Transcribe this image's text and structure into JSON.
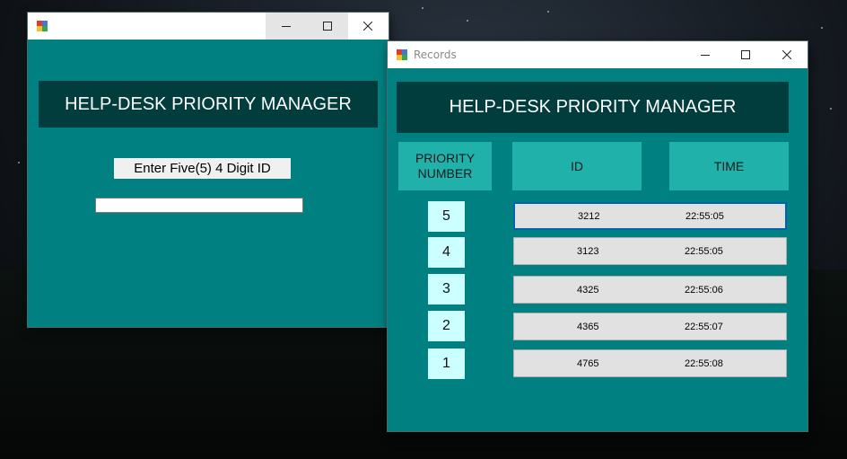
{
  "window_main": {
    "title": "",
    "banner": "HELP-DESK PRIORITY MANAGER",
    "prompt_label": "Enter Five(5) 4 Digit ID",
    "id_input_value": ""
  },
  "window_records": {
    "title": "Records",
    "banner": "HELP-DESK PRIORITY MANAGER",
    "headers": {
      "priority": "PRIORITY NUMBER",
      "id": "ID",
      "time": "TIME"
    },
    "rows": [
      {
        "priority": "5",
        "id": "3212",
        "time": "22:55:05"
      },
      {
        "priority": "4",
        "id": "3123",
        "time": "22:55:05"
      },
      {
        "priority": "3",
        "id": "4325",
        "time": "22:55:06"
      },
      {
        "priority": "2",
        "id": "4365",
        "time": "22:55:07"
      },
      {
        "priority": "1",
        "id": "4765",
        "time": "22:55:08"
      }
    ]
  },
  "colors": {
    "form_background": "#008080",
    "banner_background": "#013d3d",
    "header_background": "#20b2aa",
    "priority_cell_background": "#ccffff",
    "record_background": "#e1e1e1",
    "selection_border": "#0063b1"
  },
  "icons": [
    "app-icon",
    "minimize-icon",
    "maximize-icon",
    "close-icon"
  ]
}
